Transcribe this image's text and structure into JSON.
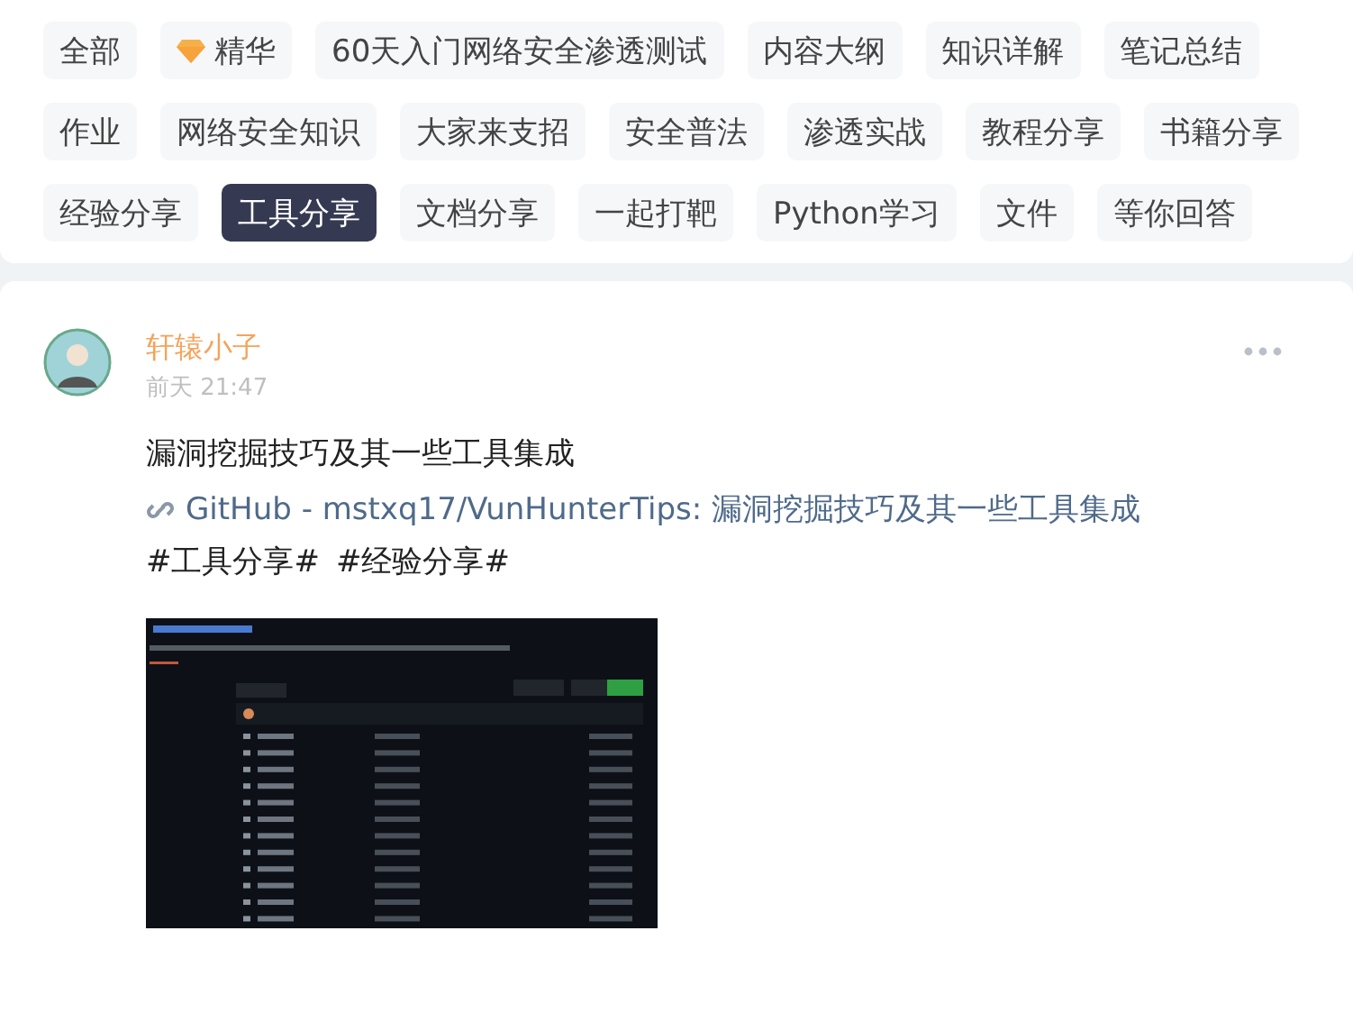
{
  "tags": [
    {
      "label": "全部",
      "kind": "plain",
      "selected": false
    },
    {
      "label": "精华",
      "kind": "featured",
      "selected": false
    },
    {
      "label": "60天入门网络安全渗透测试",
      "kind": "plain",
      "selected": false
    },
    {
      "label": "内容大纲",
      "kind": "plain",
      "selected": false
    },
    {
      "label": "知识详解",
      "kind": "plain",
      "selected": false
    },
    {
      "label": "笔记总结",
      "kind": "plain",
      "selected": false
    },
    {
      "label": "作业",
      "kind": "plain",
      "selected": false
    },
    {
      "label": "网络安全知识",
      "kind": "plain",
      "selected": false
    },
    {
      "label": "大家来支招",
      "kind": "plain",
      "selected": false
    },
    {
      "label": "安全普法",
      "kind": "plain",
      "selected": false
    },
    {
      "label": "渗透实战",
      "kind": "plain",
      "selected": false
    },
    {
      "label": "教程分享",
      "kind": "plain",
      "selected": false
    },
    {
      "label": "书籍分享",
      "kind": "plain",
      "selected": false
    },
    {
      "label": "经验分享",
      "kind": "plain",
      "selected": false
    },
    {
      "label": "工具分享",
      "kind": "plain",
      "selected": true
    },
    {
      "label": "文档分享",
      "kind": "plain",
      "selected": false
    },
    {
      "label": "一起打靶",
      "kind": "plain",
      "selected": false
    },
    {
      "label": "Python学习",
      "kind": "plain",
      "selected": false
    },
    {
      "label": "文件",
      "kind": "plain",
      "selected": false
    },
    {
      "label": "等你回答",
      "kind": "plain",
      "selected": false
    }
  ],
  "post": {
    "author": "轩辕小子",
    "time": "前天 21:47",
    "text": "漏洞挖掘技巧及其一些工具集成",
    "link": "GitHub - mstxq17/VunHunterTips: 漏洞挖掘技巧及其一些工具集成",
    "hashtags": [
      "#工具分享#",
      "#经验分享#"
    ]
  }
}
